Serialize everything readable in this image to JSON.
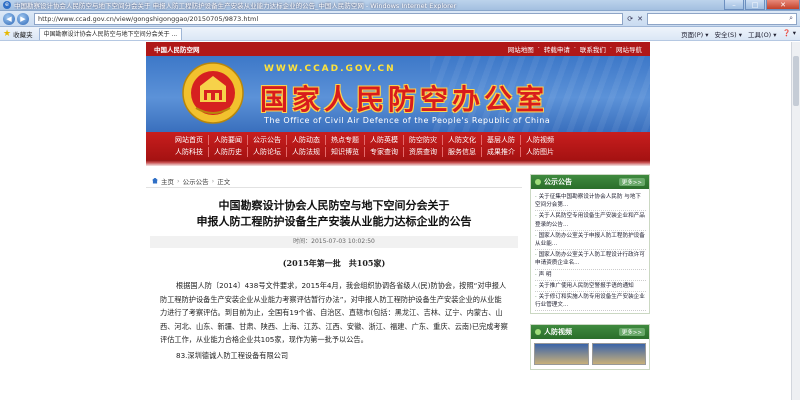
{
  "window": {
    "title": "中国勘察设计协会人民防空与地下空间分会关于 申报人防工程防护设备生产安装从业能力达标企业的公告_中国人民防空网 - Windows Internet Explorer",
    "minimize": "–",
    "maximize": "□",
    "close": "✕"
  },
  "address": {
    "url": "http://www.ccad.gov.cn/view/gongshigonggao/20150705/9873.html",
    "back": "◀",
    "forward": "▶"
  },
  "favorites": {
    "label": "收藏夹",
    "tab_title": "中国勘察设计协会人民防空与地下空间分会关于 ...",
    "tools": [
      "页面(P) ▾",
      "安全(S) ▾",
      "工具(O) ▾",
      "❓ ▾"
    ]
  },
  "site": {
    "top_brand": "中国人民防空网",
    "top_links": [
      "网站地图",
      "转载申请",
      "联系我们",
      "网站导航"
    ],
    "domain": "WWW.CCAD.GOV.CN",
    "name_cn": "国家人民防空办公室",
    "name_en": "The Office of Civil Air Defence of the People's Republic of China",
    "nav_row1": [
      "网站首页",
      "人防要闻",
      "公示公告",
      "人防动态",
      "热点专题",
      "人防英模",
      "防空防灾",
      "人防文化",
      "基层人防",
      "人防视频"
    ],
    "nav_row2": [
      "人防科技",
      "人防历史",
      "人防论坛",
      "人防法规",
      "知识博览",
      "专家查询",
      "资质查询",
      "服务信息",
      "成果推介",
      "人防图片"
    ]
  },
  "breadcrumb": [
    "主页",
    "公示公告",
    "正文"
  ],
  "article": {
    "title_line1": "中国勘察设计协会人民防空与地下空间分会关于",
    "title_line2": "申报人防工程防护设备生产安装从业能力达标企业的公告",
    "meta": "时间：2015-07-03 10:02:50",
    "batch": "(2015年第一批　共105家)",
    "body": "根据国人防〔2014〕438号文件要求，2015年4月，我会组织协调各省级人(民)防协会，按照“对申报人防工程防护设备生产安装企业从业能力考察评估暂行办法”，对申报人防工程防护设备生产安装企业的从业能力进行了考察评估。到目前为止，全国有19个省、自治区、直辖市(包括：黑龙江、吉林、辽宁、内蒙古、山西、河北、山东、新疆、甘肃、陕西、上海、江苏、江西、安徽、浙江、福建、广东、重庆、云南)已完成考察评估工作，从业能力合格企业共105家，现作为第一批予以公告。",
    "item": "83.深圳德诚人防工程设备有限公司"
  },
  "sidebar": {
    "notice_title": "公示公告",
    "more": "更多>>",
    "notices": [
      "关于征集中国勘察设计协会人民防 与地下空间分会第...",
      "关于人民防空专用设备生产安装企业和产品登录的公告...",
      "国家人防办公室关于申报人防工程防护设备从业能...",
      "国家人防办公室关于人防工程设计行政许可申请资质企业名...",
      "声 明",
      "关于推广使用人民防空警报手语的通知",
      "关于修订和实施人防专用设备生产安装企业行业管理文..."
    ],
    "video_title": "人防视频"
  }
}
